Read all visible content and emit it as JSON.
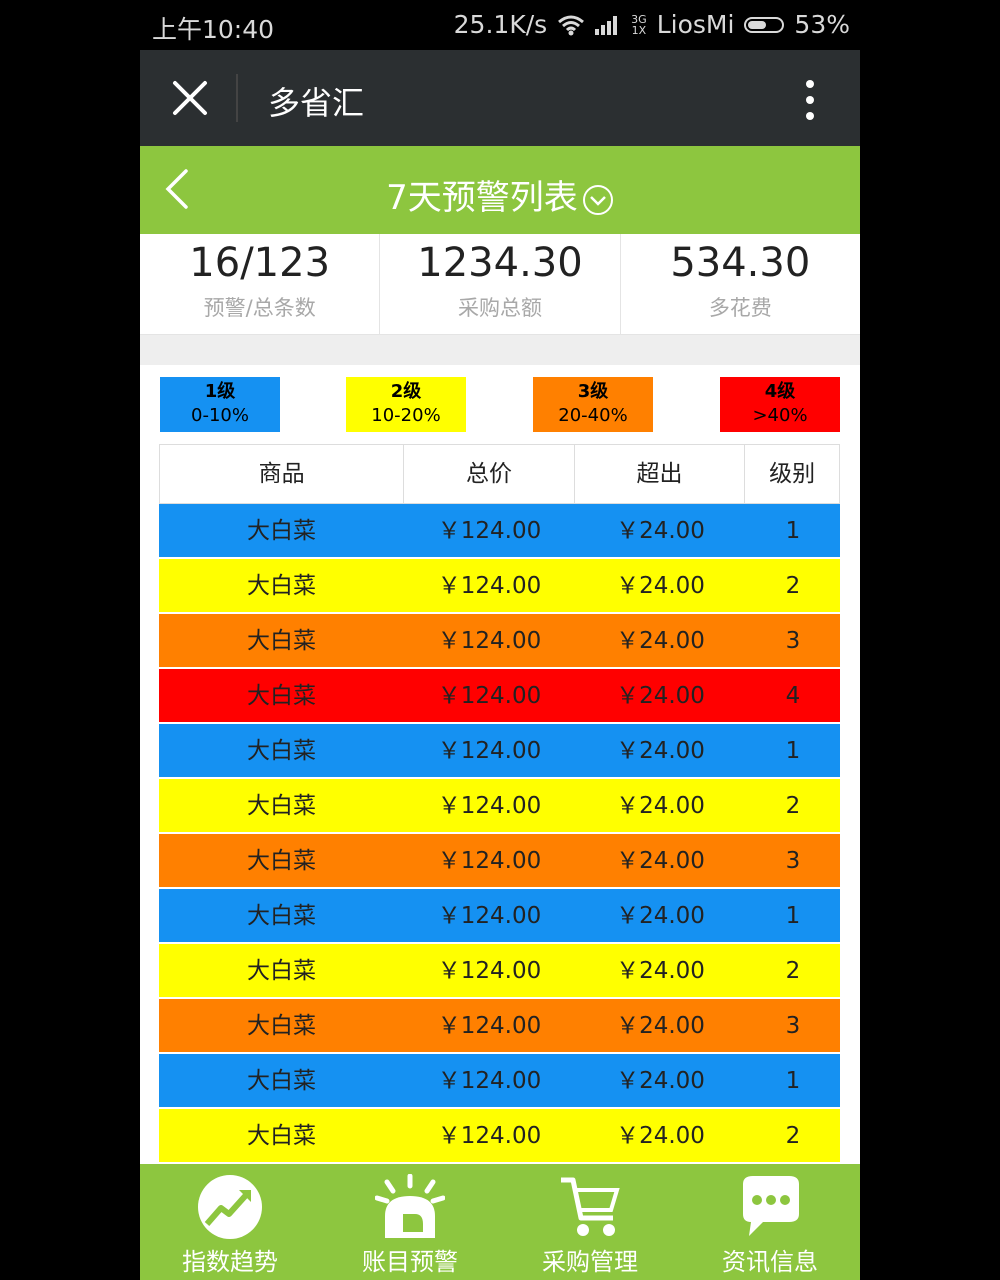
{
  "status": {
    "time": "上午10:40",
    "speed": "25.1K/s",
    "network_top": "3G",
    "network_bottom": "1X",
    "carrier": "LiosMi",
    "battery": "53%"
  },
  "window": {
    "title": "多省汇"
  },
  "header": {
    "title": "7天预警列表"
  },
  "stats": [
    {
      "value": "16/123",
      "label": "预警/总条数"
    },
    {
      "value": "1234.30",
      "label": "采购总额"
    },
    {
      "value": "534.30",
      "label": "多花费"
    }
  ],
  "legend": [
    {
      "level": "1级",
      "range": "0-10%",
      "color": "#1591f2"
    },
    {
      "level": "2级",
      "range": "10-20%",
      "color": "#ffff00"
    },
    {
      "level": "3级",
      "range": "20-40%",
      "color": "#ff8000"
    },
    {
      "level": "4级",
      "range": ">40%",
      "color": "#ff0000"
    }
  ],
  "table": {
    "headers": [
      "商品",
      "总价",
      "超出",
      "级别"
    ],
    "rows": [
      {
        "item": "大白菜",
        "total": "￥124.00",
        "over": "￥24.00",
        "level": "1"
      },
      {
        "item": "大白菜",
        "total": "￥124.00",
        "over": "￥24.00",
        "level": "2"
      },
      {
        "item": "大白菜",
        "total": "￥124.00",
        "over": "￥24.00",
        "level": "3"
      },
      {
        "item": "大白菜",
        "total": "￥124.00",
        "over": "￥24.00",
        "level": "4"
      },
      {
        "item": "大白菜",
        "total": "￥124.00",
        "over": "￥24.00",
        "level": "1"
      },
      {
        "item": "大白菜",
        "total": "￥124.00",
        "over": "￥24.00",
        "level": "2"
      },
      {
        "item": "大白菜",
        "total": "￥124.00",
        "over": "￥24.00",
        "level": "3"
      },
      {
        "item": "大白菜",
        "total": "￥124.00",
        "over": "￥24.00",
        "level": "1"
      },
      {
        "item": "大白菜",
        "total": "￥124.00",
        "over": "￥24.00",
        "level": "2"
      },
      {
        "item": "大白菜",
        "total": "￥124.00",
        "over": "￥24.00",
        "level": "3"
      },
      {
        "item": "大白菜",
        "total": "￥124.00",
        "over": "￥24.00",
        "level": "1"
      },
      {
        "item": "大白菜",
        "total": "￥124.00",
        "over": "￥24.00",
        "level": "2"
      }
    ]
  },
  "nav": [
    {
      "label": "指数趋势",
      "icon": "trend-chart-icon"
    },
    {
      "label": "账目预警",
      "icon": "alarm-siren-icon"
    },
    {
      "label": "采购管理",
      "icon": "shopping-cart-icon"
    },
    {
      "label": "资讯信息",
      "icon": "chat-bubble-icon"
    }
  ],
  "colors": {
    "green": "#8dc63f",
    "titlebar": "#2b2f31"
  }
}
